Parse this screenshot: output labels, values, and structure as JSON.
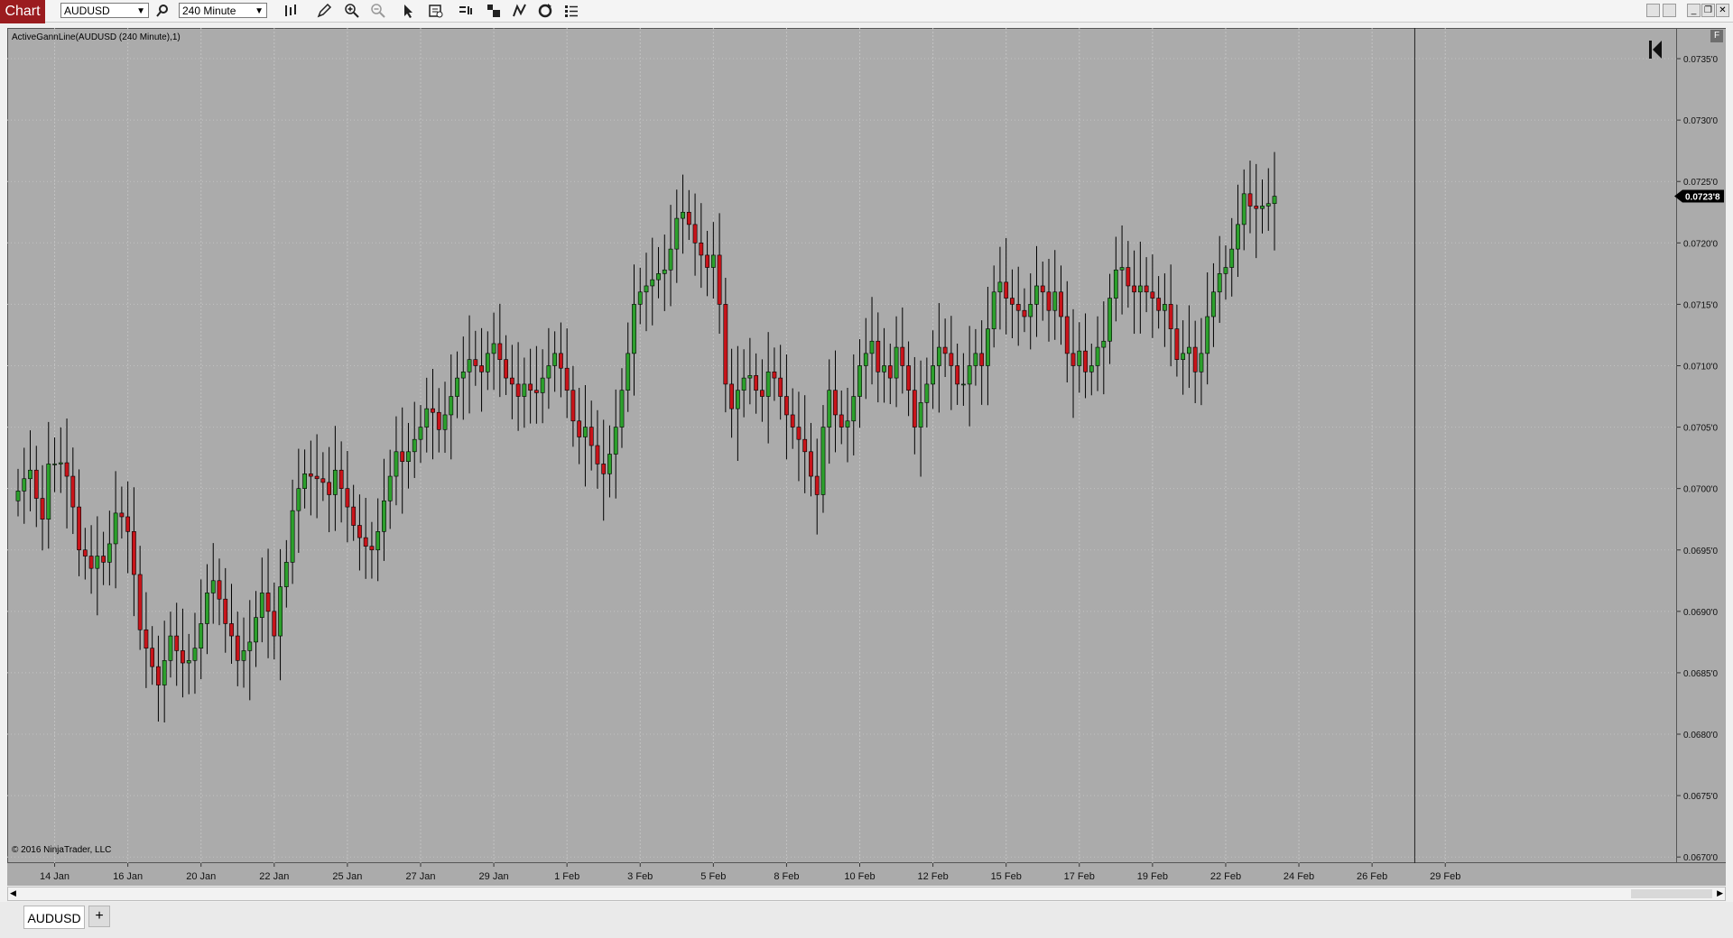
{
  "toolbar": {
    "app_tab": "Chart",
    "instrument": "AUDUSD",
    "interval": "240 Minute",
    "icons": [
      "search-icon",
      "bars-type-icon",
      "pencil-draw-icon",
      "zoom-in-icon",
      "zoom-out-icon",
      "pointer-icon",
      "properties-icon",
      "data-box-icon",
      "strategies-icon",
      "indicators-icon",
      "reload-icon",
      "list-icon"
    ],
    "window_buttons": [
      "minimize-icon",
      "maximize-icon",
      "restore-icon",
      "close-icon"
    ]
  },
  "indicator_label": "ActiveGannLine(AUDUSD (240 Minute),1)",
  "copyright": "© 2016 NinjaTrader, LLC",
  "price_marker": "0.0723'8",
  "tabs": {
    "active": "AUDUSD",
    "add": "+"
  },
  "chart_data": {
    "type": "candlestick",
    "instrument": "AUDUSD",
    "interval": "240 Minute",
    "colors": {
      "up": "#2ca02c",
      "down": "#c8141a",
      "background": "#ababab",
      "wick": "#000000"
    },
    "grid": true,
    "ylim": [
      0.06695,
      0.07375
    ],
    "yticks": [
      0.067,
      0.0675,
      0.068,
      0.0685,
      0.069,
      0.0695,
      0.07,
      0.0705,
      0.071,
      0.0715,
      0.072,
      0.0725,
      0.073,
      0.0735
    ],
    "ytick_labels": [
      "0.0670'0",
      "0.0675'0",
      "0.0680'0",
      "0.0685'0",
      "0.0690'0",
      "0.0695'0",
      "0.0700'0",
      "0.0705'0",
      "0.0710'0",
      "0.0715'0",
      "0.0720'0",
      "0.0725'0",
      "0.0730'0",
      "0.0735'0"
    ],
    "xtick_labels": [
      "14 Jan",
      "16 Jan",
      "20 Jan",
      "22 Jan",
      "25 Jan",
      "27 Jan",
      "29 Jan",
      "1 Feb",
      "3 Feb",
      "5 Feb",
      "8 Feb",
      "10 Feb",
      "12 Feb",
      "15 Feb",
      "17 Feb",
      "19 Feb",
      "22 Feb",
      "24 Feb",
      "26 Feb",
      "29 Feb"
    ],
    "xtick_bar_index": [
      6,
      18,
      30,
      42,
      54,
      66,
      78,
      90,
      102,
      114,
      126,
      138,
      150,
      162,
      174,
      186,
      198,
      210,
      222,
      234
    ],
    "total_bar_slots": 272,
    "current_time_bar_index": 229,
    "last_price": 0.07238,
    "closes": [
      0.06998,
      0.07008,
      0.07015,
      0.06992,
      0.06975,
      0.0702,
      0.0702,
      0.07021,
      0.0701,
      0.06985,
      0.0695,
      0.06945,
      0.06935,
      0.06945,
      0.0694,
      0.06955,
      0.0698,
      0.06977,
      0.06965,
      0.0693,
      0.06885,
      0.0687,
      0.06855,
      0.0684,
      0.0686,
      0.0688,
      0.06868,
      0.06858,
      0.0686,
      0.0687,
      0.0689,
      0.06915,
      0.06925,
      0.0691,
      0.0689,
      0.0688,
      0.0686,
      0.06868,
      0.06875,
      0.06895,
      0.06915,
      0.069,
      0.0688,
      0.0692,
      0.0694,
      0.06982,
      0.07,
      0.07012,
      0.0701,
      0.07008,
      0.07005,
      0.06995,
      0.07015,
      0.07,
      0.06985,
      0.0697,
      0.0696,
      0.06953,
      0.0695,
      0.06965,
      0.0699,
      0.0701,
      0.0703,
      0.07022,
      0.0703,
      0.0704,
      0.0705,
      0.07065,
      0.07062,
      0.07048,
      0.0706,
      0.07075,
      0.0709,
      0.07095,
      0.07105,
      0.071,
      0.07095,
      0.0711,
      0.07118,
      0.07105,
      0.0709,
      0.07085,
      0.07075,
      0.07085,
      0.0708,
      0.07078,
      0.0709,
      0.071,
      0.0711,
      0.07098,
      0.0708,
      0.07055,
      0.07042,
      0.0705,
      0.07035,
      0.0702,
      0.07012,
      0.07028,
      0.0705,
      0.0708,
      0.0711,
      0.0715,
      0.0716,
      0.07165,
      0.0717,
      0.07175,
      0.07178,
      0.07195,
      0.0722,
      0.07225,
      0.07215,
      0.072,
      0.0719,
      0.0718,
      0.0719,
      0.0715,
      0.07085,
      0.07065,
      0.0708,
      0.0709,
      0.07092,
      0.0708,
      0.07075,
      0.07095,
      0.0709,
      0.07075,
      0.0706,
      0.0705,
      0.0704,
      0.0703,
      0.0701,
      0.06995,
      0.0705,
      0.0708,
      0.0706,
      0.0705,
      0.07055,
      0.07075,
      0.071,
      0.0711,
      0.0712,
      0.07095,
      0.071,
      0.0709,
      0.07115,
      0.071,
      0.0708,
      0.0705,
      0.0707,
      0.07085,
      0.071,
      0.07115,
      0.0711,
      0.071,
      0.07085,
      0.07085,
      0.071,
      0.0711,
      0.071,
      0.0713,
      0.0716,
      0.07168,
      0.07155,
      0.0715,
      0.07145,
      0.0714,
      0.0715,
      0.07165,
      0.0716,
      0.07145,
      0.0716,
      0.0714,
      0.0711,
      0.071,
      0.07112,
      0.07095,
      0.071,
      0.07115,
      0.0712,
      0.07155,
      0.07178,
      0.0718,
      0.07165,
      0.0716,
      0.07165,
      0.0716,
      0.07155,
      0.07145,
      0.0715,
      0.0713,
      0.07105,
      0.0711,
      0.07115,
      0.07095,
      0.0711,
      0.0714,
      0.0716,
      0.07175,
      0.0718,
      0.07195,
      0.07215,
      0.0724,
      0.0723,
      0.07228,
      0.0723,
      0.07232,
      0.07238
    ]
  }
}
